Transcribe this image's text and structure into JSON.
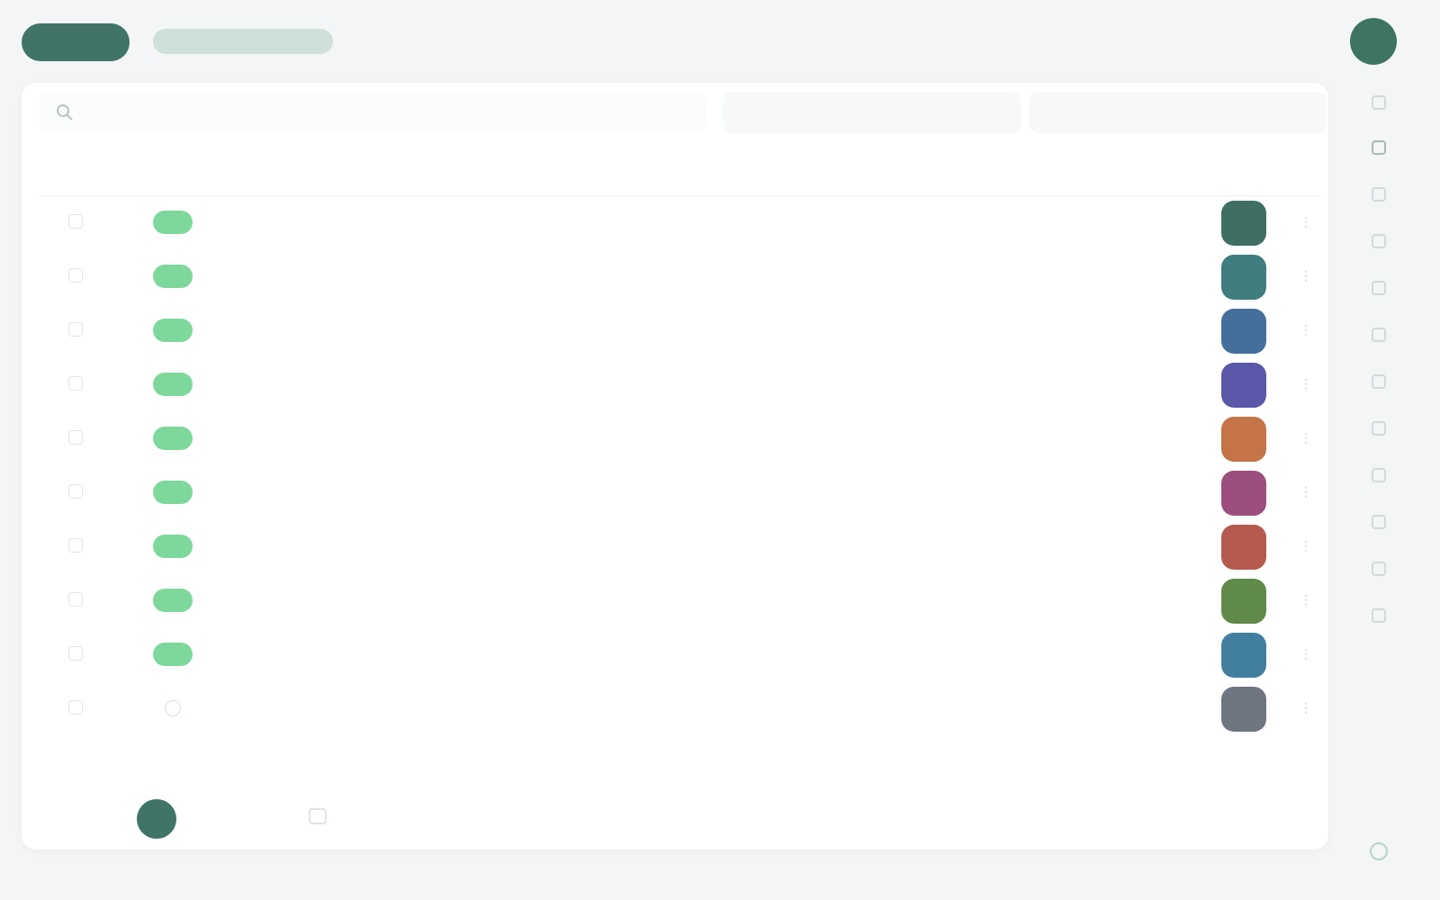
{
  "header": {
    "brand_pill": "",
    "subtitle": "",
    "label": "",
    "avatar_initials": ""
  },
  "toolbar": {
    "search_placeholder": "",
    "date_label": "",
    "range_label": ""
  },
  "table": {
    "columns": [
      "",
      "",
      "",
      "",
      "",
      "",
      "",
      "",
      "",
      "",
      ""
    ],
    "rows": [
      {
        "status": "active",
        "id": "",
        "type": "",
        "a": "",
        "b": "",
        "c": "",
        "d": "",
        "name": "",
        "color": "#3f6e63"
      },
      {
        "status": "active",
        "id": "",
        "type": "",
        "a": "",
        "b": "",
        "c": "",
        "d": "",
        "name": "",
        "color": "#3f7d7e"
      },
      {
        "status": "active",
        "id": "",
        "type": "",
        "a": "",
        "b": "",
        "c": "",
        "d": "",
        "name": "",
        "color": "#456f9b"
      },
      {
        "status": "active",
        "id": "",
        "type": "",
        "a": "",
        "b": "",
        "c": "",
        "d": "",
        "name": "",
        "color": "#5b58a9"
      },
      {
        "status": "active",
        "id": "",
        "type": "",
        "a": "",
        "b": "",
        "c": "",
        "d": "",
        "name": "",
        "color": "#c47447"
      },
      {
        "status": "active",
        "id": "",
        "type": "",
        "a": "",
        "b": "",
        "c": "",
        "d": "",
        "name": "",
        "color": "#9c4f7c"
      },
      {
        "status": "active",
        "id": "",
        "type": "",
        "a": "",
        "b": "",
        "c": "",
        "d": "",
        "name": "",
        "color": "#b55a4e"
      },
      {
        "status": "active",
        "id": "",
        "type": "",
        "a": "",
        "b": "",
        "c": "",
        "d": "",
        "name": "",
        "color": "#5f8a4a"
      },
      {
        "status": "active",
        "id": "",
        "type": "",
        "a": "",
        "b": "",
        "c": "",
        "d": "",
        "name": "",
        "color": "#427f9f"
      },
      {
        "status": "pending",
        "id": "",
        "type": "",
        "a": "",
        "b": "",
        "c": "",
        "d": "",
        "name": "",
        "color": "#707582"
      }
    ]
  },
  "pagination": {
    "prev": "",
    "current": "",
    "next": "",
    "info": "",
    "total": ""
  },
  "rail": {
    "icons": [
      "rail-icon-1",
      "rail-icon-2",
      "rail-icon-3",
      "rail-icon-4",
      "rail-icon-5",
      "rail-icon-6",
      "rail-icon-7",
      "rail-icon-8",
      "rail-icon-9",
      "rail-icon-10",
      "rail-icon-11",
      "rail-icon-12"
    ]
  },
  "colors": {
    "accent": "#3f7466",
    "status_active": "#7ed89c",
    "status_pending": "#f2c14e"
  }
}
